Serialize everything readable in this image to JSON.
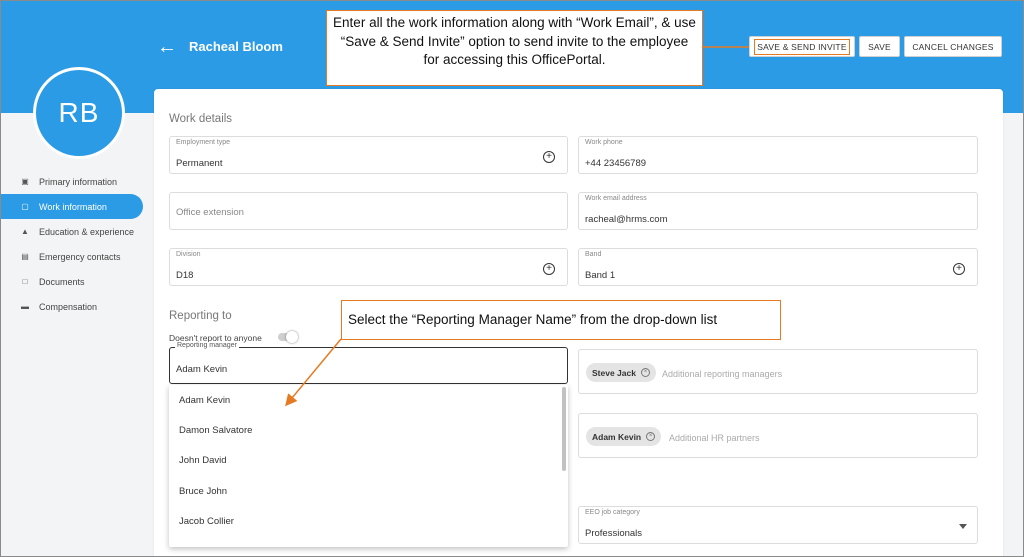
{
  "header": {
    "employee_name": "Racheal Bloom",
    "avatar_initials": "RB",
    "buttons": {
      "save_invite": "SAVE & SEND INVITE",
      "save": "SAVE",
      "cancel": "CANCEL CHANGES"
    }
  },
  "sidebar": {
    "items": [
      {
        "label": "Primary information",
        "icon": "id-card-icon"
      },
      {
        "label": "Work information",
        "icon": "briefcase-icon"
      },
      {
        "label": "Education & experience",
        "icon": "graduation-cap-icon"
      },
      {
        "label": "Emergency contacts",
        "icon": "contacts-icon"
      },
      {
        "label": "Documents",
        "icon": "folder-icon"
      },
      {
        "label": "Compensation",
        "icon": "wallet-icon"
      }
    ],
    "active_index": 1
  },
  "work_details": {
    "title": "Work details",
    "employment_type": {
      "label": "Employment type",
      "value": "Permanent"
    },
    "work_phone": {
      "label": "Work phone",
      "value": "+44 23456789"
    },
    "office_extension": {
      "placeholder": "Office extension"
    },
    "work_email": {
      "label": "Work email address",
      "value": "racheal@hrms.com"
    },
    "division": {
      "label": "Division",
      "value": "D18"
    },
    "band": {
      "label": "Band",
      "value": "Band 1"
    }
  },
  "reporting": {
    "title": "Reporting to",
    "toggle_label": "Doesn't report to anyone",
    "toggle_on": false,
    "manager": {
      "label": "Reporting manager",
      "value": "Adam Kevin"
    },
    "dropdown_options": [
      "Adam Kevin",
      "Damon Salvatore",
      "John David",
      "Bruce John",
      "Jacob Collier"
    ],
    "additional_managers": {
      "chip": "Steve Jack",
      "placeholder": "Additional reporting managers"
    },
    "hr_partners": {
      "chip": "Adam Kevin",
      "placeholder": "Additional HR partners"
    },
    "eeo": {
      "label": "EEO job category",
      "value": "Professionals"
    }
  },
  "annotations": {
    "callout_top": "Enter all the work information along with “Work Email”, & use “Save & Send Invite” option to send invite to the employee for accessing this OfficePortal.",
    "callout_dropdown": "Select the “Reporting Manager Name” from the drop-down list"
  },
  "colors": {
    "primary": "#2b9be5",
    "callout_border": "#e67a22"
  }
}
